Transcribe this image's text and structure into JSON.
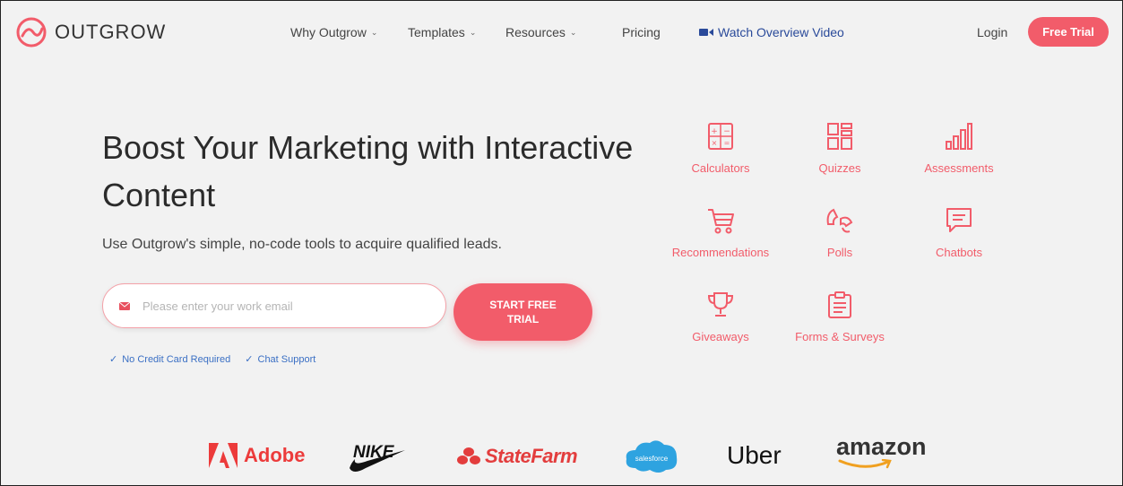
{
  "header": {
    "logo_text": "OUTGROW",
    "nav": [
      {
        "label": "Why Outgrow",
        "has_dropdown": true
      },
      {
        "label": "Templates",
        "has_dropdown": true
      },
      {
        "label": "Resources",
        "has_dropdown": true
      },
      {
        "label": "Pricing",
        "has_dropdown": false
      }
    ],
    "video_link": "Watch Overview Video",
    "login": "Login",
    "free_trial": "Free Trial"
  },
  "hero": {
    "title": "Boost Your Marketing with Interactive Content",
    "subtitle": "Use Outgrow's simple, no-code tools to acquire qualified leads.",
    "email_placeholder": "Please enter your work email",
    "cta": "START FREE TRIAL",
    "checks": [
      "No Credit Card Required",
      "Chat Support"
    ]
  },
  "tools": [
    {
      "label": "Calculators",
      "icon": "calculator-icon"
    },
    {
      "label": "Quizzes",
      "icon": "quiz-icon"
    },
    {
      "label": "Assessments",
      "icon": "bar-chart-icon"
    },
    {
      "label": "Recommendations",
      "icon": "cart-icon"
    },
    {
      "label": "Polls",
      "icon": "poll-icon"
    },
    {
      "label": "Chatbots",
      "icon": "chat-icon"
    },
    {
      "label": "Giveaways",
      "icon": "trophy-icon"
    },
    {
      "label": "Forms & Surveys",
      "icon": "clipboard-icon"
    }
  ],
  "brands": {
    "adobe": "Adobe",
    "nike": "NIKE",
    "statefarm": "StateFarm",
    "salesforce": "salesforce",
    "uber": "Uber",
    "amazon": "amazon"
  },
  "colors": {
    "accent": "#f25c6a",
    "link": "#2a4a9a",
    "check": "#3a6fc4"
  }
}
